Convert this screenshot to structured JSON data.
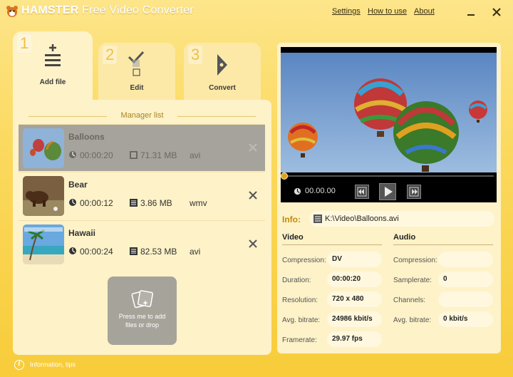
{
  "app": {
    "title_brand": "HAMSTER",
    "title_rest": " Free Video Converter",
    "menu": {
      "settings": "Settings",
      "how_to_use": "How to use",
      "about": "About"
    }
  },
  "tabs": [
    {
      "number": "1",
      "label": "Add file",
      "icon": "add-file-icon"
    },
    {
      "number": "2",
      "label": "Edit",
      "icon": "edit-checkbox-icon"
    },
    {
      "number": "3",
      "label": "Convert",
      "icon": "convert-arrow-icon"
    }
  ],
  "manager": {
    "heading": "Manager list",
    "files": [
      {
        "name": "Balloons",
        "duration": "00:00:20",
        "size": "71.31 MB",
        "format": "avi",
        "selected": true
      },
      {
        "name": "Bear",
        "duration": "00:00:12",
        "size": "3.86 MB",
        "format": "wmv",
        "selected": false
      },
      {
        "name": "Hawaii",
        "duration": "00:00:24",
        "size": "82.53 MB",
        "format": "avi",
        "selected": false
      }
    ],
    "drop_button": {
      "line1": "Press me to add",
      "line2": "files or drop"
    }
  },
  "footer": {
    "tips": "Information, tips"
  },
  "player": {
    "time": "00.00.00"
  },
  "info": {
    "label": "Info:",
    "path": "K:\\Video\\Balloons.avi",
    "video": {
      "heading": "Video",
      "compression_label": "Compression:",
      "compression": "DV",
      "duration_label": "Duration:",
      "duration": "00:00:20",
      "resolution_label": "Resolution:",
      "resolution": "720 x 480",
      "bitrate_label": "Avg. bitrate:",
      "bitrate": "24986 kbit/s",
      "framerate_label": "Framerate:",
      "framerate": "29.97 fps"
    },
    "audio": {
      "heading": "Audio",
      "compression_label": "Compression:",
      "compression": "",
      "samplerate_label": "Samplerate:",
      "samplerate": "0",
      "channels_label": "Channels:",
      "channels": "",
      "bitrate_label": "Avg. bitrate:",
      "bitrate": "0 kbit/s"
    }
  }
}
